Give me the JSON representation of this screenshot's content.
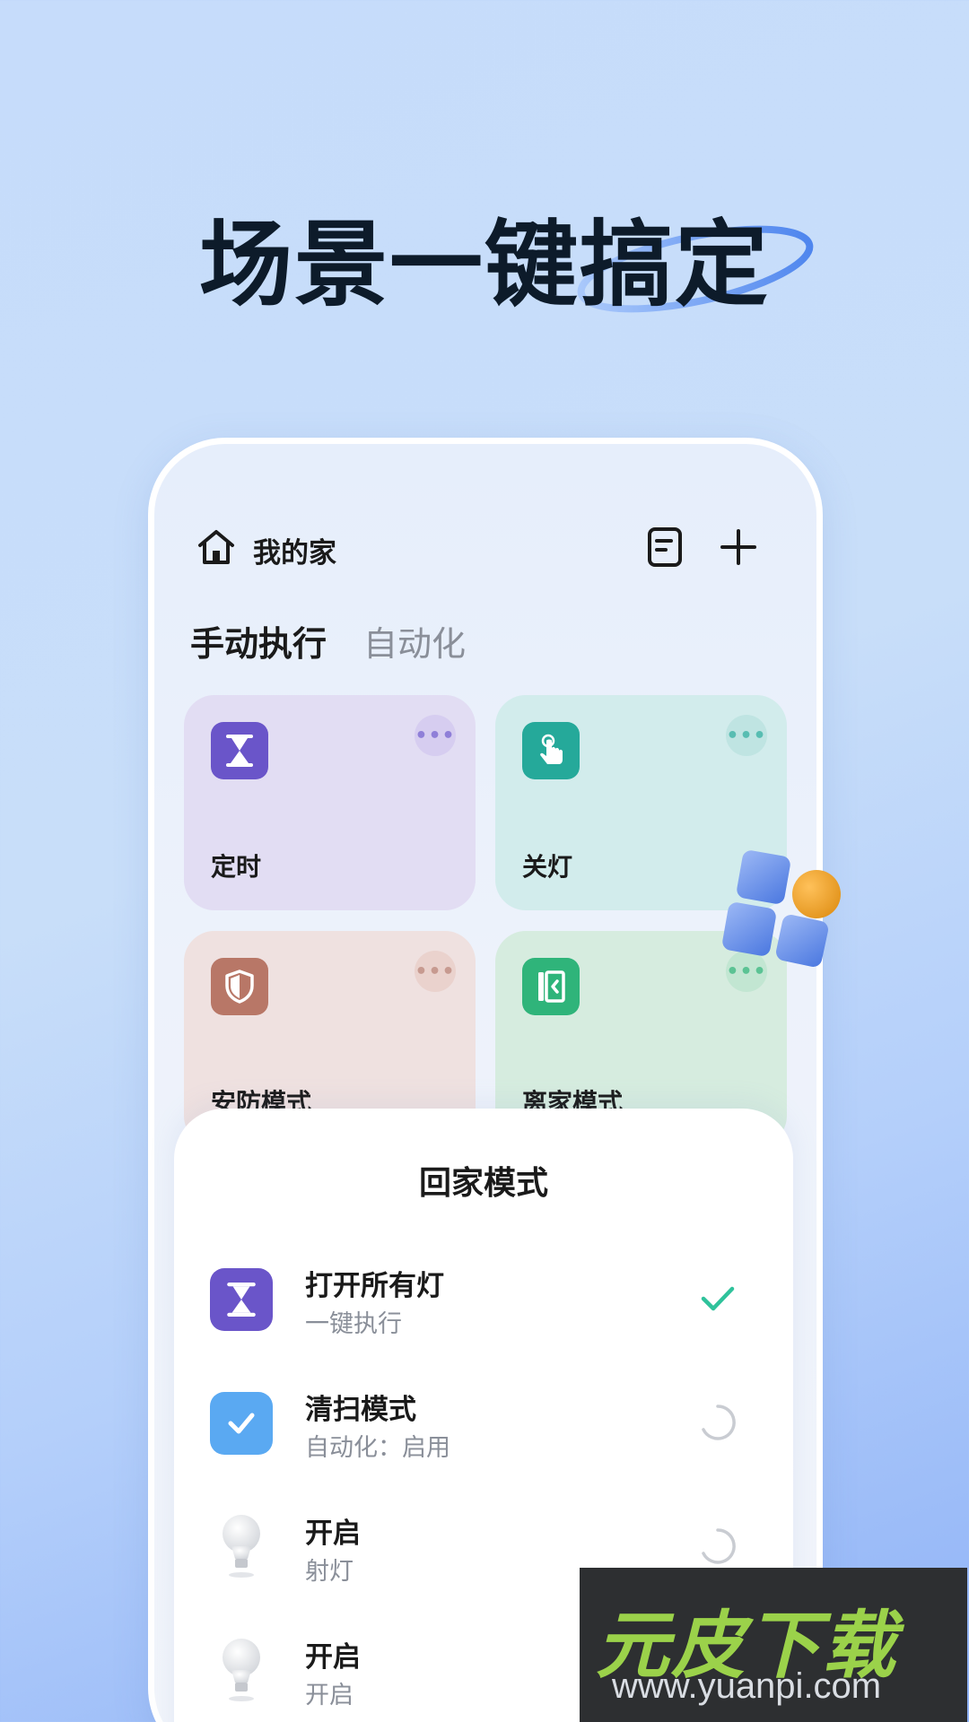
{
  "headline": "场景一键搞定",
  "header": {
    "title": "我的家"
  },
  "tabs": {
    "active": "手动执行",
    "inactive": "自动化"
  },
  "cards": [
    {
      "label": "定时",
      "icon": "hourglass-icon",
      "icon_color": "#6a55c9"
    },
    {
      "label": "关灯",
      "icon": "tap-icon",
      "icon_color": "#25a99a"
    },
    {
      "label": "安防模式",
      "icon": "shield-icon",
      "icon_color": "#b87767"
    },
    {
      "label": "离家模式",
      "icon": "door-exit-icon",
      "icon_color": "#2fb47a"
    }
  ],
  "sheet": {
    "title": "回家模式",
    "rows": [
      {
        "title": "打开所有灯",
        "subtitle": "一键执行",
        "icon": "hourglass-icon",
        "state": "checked"
      },
      {
        "title": "清扫模式",
        "subtitle": "自动化：启用",
        "icon": "checkbox-icon",
        "state": "loading"
      },
      {
        "title": "开启",
        "subtitle": "射灯",
        "icon": "bulb-icon",
        "state": "loading"
      },
      {
        "title": "开启",
        "subtitle": "开启",
        "icon": "bulb-icon",
        "state": "loading"
      }
    ]
  },
  "watermark": {
    "title": "元皮下载",
    "url": "www.yuanpi.com"
  },
  "colors": {
    "accent_green": "#2fc29b",
    "purple": "#6a55c9"
  }
}
